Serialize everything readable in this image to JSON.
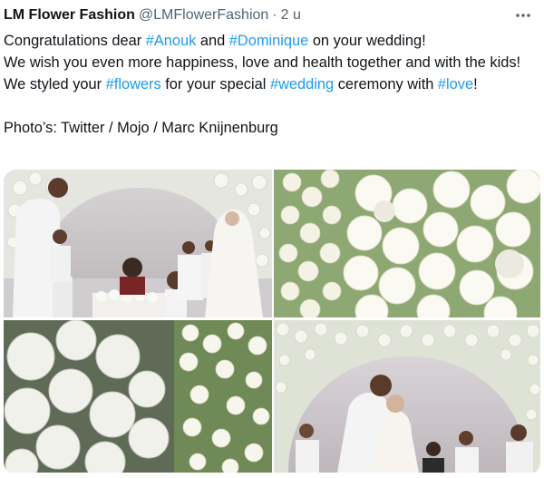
{
  "tweet": {
    "author_name": "LM Flower Fashion",
    "author_handle": "@LMFlowerFashion",
    "separator": "·",
    "time": "2 u",
    "more_icon": "ellipsis-horizontal-icon",
    "line1_pre": "Congratulations dear ",
    "line1_tag1": "#Anouk",
    "line1_mid": " and ",
    "line1_tag2": "#Dominique",
    "line1_post": " on your wedding!",
    "line2": "We wish you even more happiness, love and health together and with the kids!",
    "line3_pre": "We styled your ",
    "line3_tag1": "#flowers",
    "line3_mid": " for your special ",
    "line3_tag2": "#wedding",
    "line3_mid2": " ceremony with ",
    "line3_tag3": "#love",
    "line3_post": "!",
    "photo_credit": "Photo’s: Twitter / Mojo / Marc Knijnenburg"
  },
  "colors": {
    "text": "#0f1419",
    "muted": "#536471",
    "link": "#1d9bf0",
    "background": "#ffffff"
  }
}
